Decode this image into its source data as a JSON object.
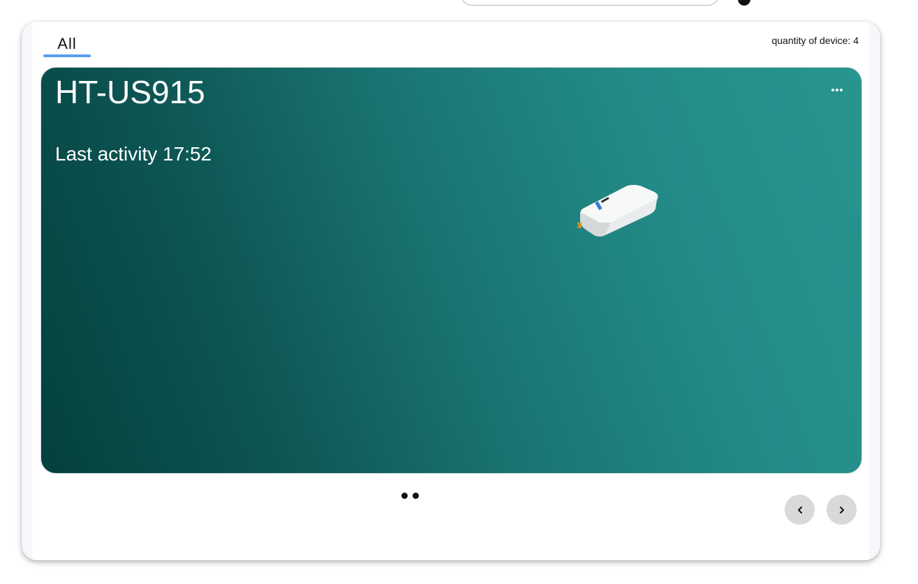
{
  "tabs": [
    {
      "label": "All",
      "active": true
    }
  ],
  "device_count_label": "quantity of device: 4",
  "accent_color": "#5b9bf0",
  "card": {
    "title": "HT-US915",
    "last_activity": "Last activity 17:52",
    "more_icon": "more-horizontal-icon",
    "gradient": [
      "#04403d",
      "#28958f"
    ]
  },
  "carousel": {
    "dots": 2,
    "prev_icon": "chevron-left-icon",
    "next_icon": "chevron-right-icon"
  }
}
